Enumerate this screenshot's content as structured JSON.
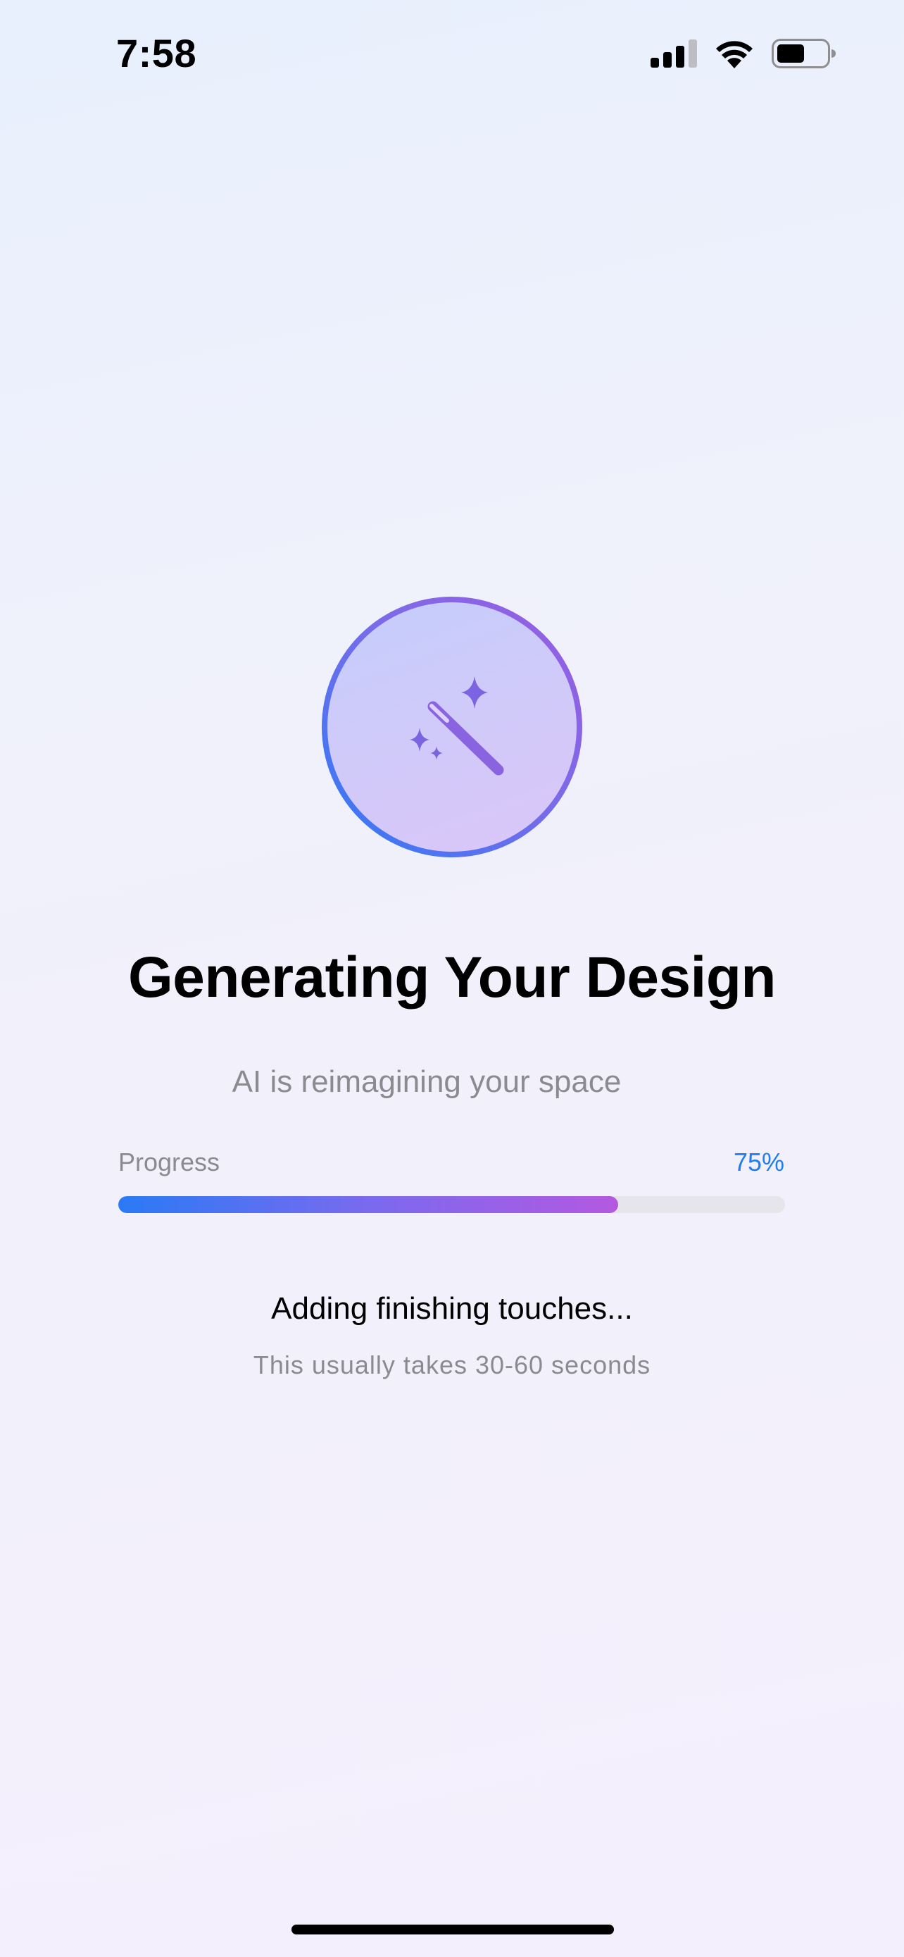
{
  "status_bar": {
    "time": "7:58",
    "icons": [
      "cellular-signal-icon",
      "wifi-icon",
      "battery-icon"
    ]
  },
  "hero": {
    "icon": "magic-wand-icon",
    "title": "Generating Your Design",
    "subtitle": "AI is reimagining your space"
  },
  "progress": {
    "label": "Progress",
    "value_text": "75%",
    "value": 0.75
  },
  "status": {
    "message": "Adding finishing touches...",
    "hint": "This usually takes 30-60 seconds"
  },
  "colors": {
    "accent_blue": "#1e7ef0",
    "accent_purple": "#b359e0",
    "secondary_text": "#8a8a90",
    "track": "#e7e5ec"
  }
}
